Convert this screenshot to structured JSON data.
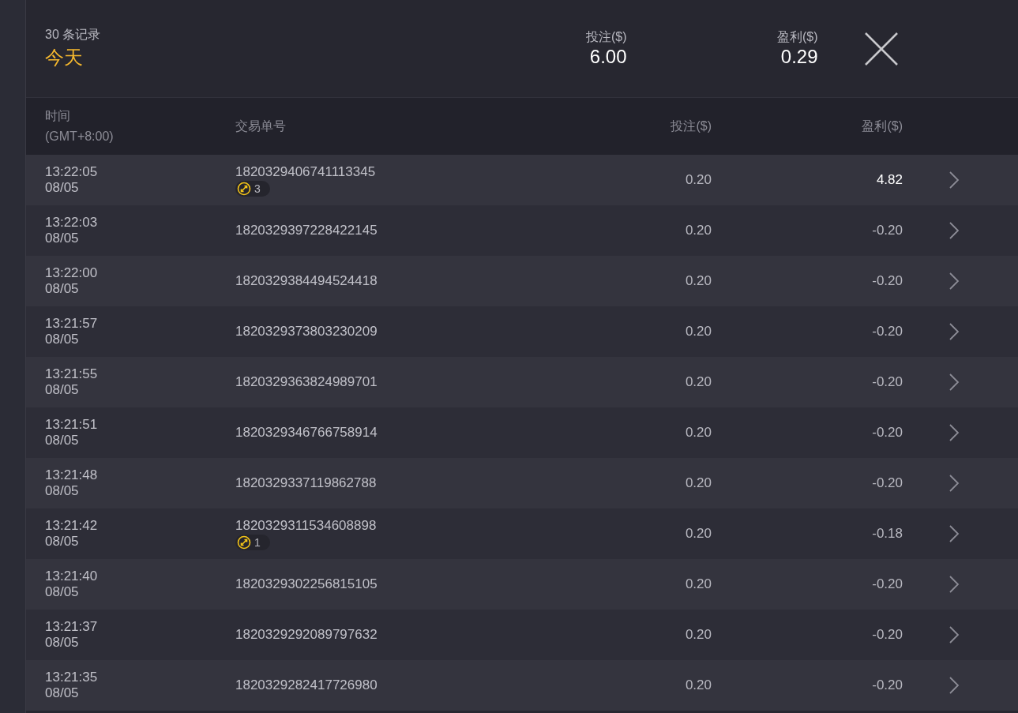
{
  "summary": {
    "count": "30 条记录",
    "period": "今天",
    "stake_label": "投注($)",
    "stake": "6.00",
    "profit_label": "盈利($)",
    "profit": "0.29"
  },
  "columns": {
    "time": "时间",
    "timezone": "(GMT+8:00)",
    "order": "交易单号",
    "stake": "投注($)",
    "profit": "盈利($)"
  },
  "rows": [
    {
      "time": "13:22:05",
      "date": "08/05",
      "order": "1820329406741113345",
      "badge": "3",
      "stake": "0.20",
      "profit": "4.82",
      "win": true
    },
    {
      "time": "13:22:03",
      "date": "08/05",
      "order": "1820329397228422145",
      "stake": "0.20",
      "profit": "-0.20",
      "win": false
    },
    {
      "time": "13:22:00",
      "date": "08/05",
      "order": "1820329384494524418",
      "stake": "0.20",
      "profit": "-0.20",
      "win": false
    },
    {
      "time": "13:21:57",
      "date": "08/05",
      "order": "1820329373803230209",
      "stake": "0.20",
      "profit": "-0.20",
      "win": false
    },
    {
      "time": "13:21:55",
      "date": "08/05",
      "order": "1820329363824989701",
      "stake": "0.20",
      "profit": "-0.20",
      "win": false
    },
    {
      "time": "13:21:51",
      "date": "08/05",
      "order": "1820329346766758914",
      "stake": "0.20",
      "profit": "-0.20",
      "win": false
    },
    {
      "time": "13:21:48",
      "date": "08/05",
      "order": "1820329337119862788",
      "stake": "0.20",
      "profit": "-0.20",
      "win": false
    },
    {
      "time": "13:21:42",
      "date": "08/05",
      "order": "1820329311534608898",
      "badge": "1",
      "stake": "0.20",
      "profit": "-0.18",
      "win": false
    },
    {
      "time": "13:21:40",
      "date": "08/05",
      "order": "1820329302256815105",
      "stake": "0.20",
      "profit": "-0.20",
      "win": false
    },
    {
      "time": "13:21:37",
      "date": "08/05",
      "order": "1820329292089797632",
      "stake": "0.20",
      "profit": "-0.20",
      "win": false
    },
    {
      "time": "13:21:35",
      "date": "08/05",
      "order": "1820329282417726980",
      "stake": "0.20",
      "profit": "-0.20",
      "win": false
    }
  ]
}
